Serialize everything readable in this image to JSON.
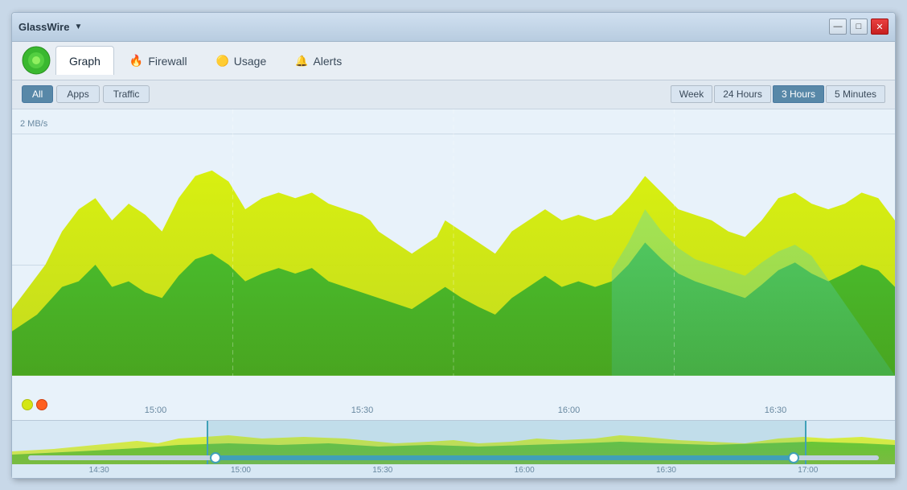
{
  "window": {
    "title": "GlassWire",
    "controls": {
      "minimize": "—",
      "maximize": "□",
      "close": "✕"
    }
  },
  "nav": {
    "tabs": [
      {
        "id": "graph",
        "label": "Graph",
        "icon": "🟢",
        "active": true
      },
      {
        "id": "firewall",
        "label": "Firewall",
        "icon": "🔥",
        "active": false
      },
      {
        "id": "usage",
        "label": "Usage",
        "icon": "🟡",
        "active": false
      },
      {
        "id": "alerts",
        "label": "Alerts",
        "icon": "🔔",
        "active": false
      }
    ]
  },
  "filters": {
    "left": [
      {
        "id": "all",
        "label": "All",
        "active": true
      },
      {
        "id": "apps",
        "label": "Apps",
        "active": false
      },
      {
        "id": "traffic",
        "label": "Traffic",
        "active": false
      }
    ],
    "time": [
      {
        "id": "week",
        "label": "Week",
        "active": false
      },
      {
        "id": "24hours",
        "label": "24 Hours",
        "active": false
      },
      {
        "id": "3hours",
        "label": "3 Hours",
        "active": true
      },
      {
        "id": "5minutes",
        "label": "5 Minutes",
        "active": false
      }
    ]
  },
  "chart": {
    "y_label": "2 MB/s",
    "x_labels": [
      "15:00",
      "15:30",
      "16:00",
      "16:30"
    ],
    "colors": {
      "yellow": "#d4e614",
      "green": "#3ab830",
      "teal": "#50c8a0"
    }
  },
  "mini_chart": {
    "x_labels": [
      "14:30",
      "15:00",
      "15:30",
      "16:00",
      "16:30",
      "17:00"
    ]
  },
  "colors": {
    "accent": "#5888a8",
    "active_time": "#5888a8",
    "window_bg": "#f0f4f8",
    "chart_bg": "#e8f2fa"
  }
}
